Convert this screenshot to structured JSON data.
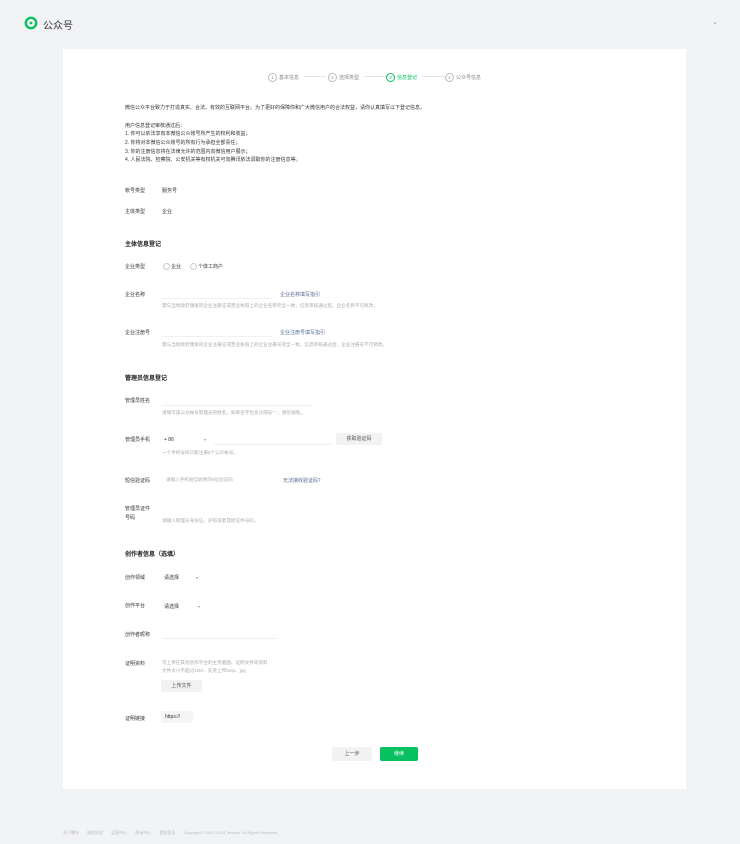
{
  "header": {
    "brand": "公众号"
  },
  "steps": [
    {
      "num": "1",
      "label": "基本信息"
    },
    {
      "num": "2",
      "label": "选择类型"
    },
    {
      "num": "3",
      "label": "信息登记"
    },
    {
      "num": "4",
      "label": "公众号信息"
    }
  ],
  "intro": {
    "line1": "微信公众平台致力于打造真实、合法、有效的互联网平台。为了更好的保障你和广大微信用户的合法权益，请你认真填写以下登记信息。",
    "review_title": "用户信息登记审核通过后：",
    "items": [
      "1. 你可以依法享有本微信公众账号所产生的权利和收益；",
      "2. 你将对本微信公众账号的所有行为承担全部责任；",
      "3. 你的注册信息将在法律允许的范围内向微信用户展示；",
      "4. 人民法院、检察院、公安机关等有权机关可向腾讯依法调取你的注册信息等。"
    ]
  },
  "account": {
    "type_label": "帐号类型",
    "type_value": "服务号",
    "subject_label": "主体类型",
    "subject_value": "企业"
  },
  "subject_section": {
    "title": "主体信息登记",
    "org_type_label": "企业类型",
    "org_type_options": [
      "企业",
      "个体工商户"
    ],
    "name_label": "企业名称",
    "name_link": "企业名称填写指引",
    "name_hint": "需与当地政府颁发的企业注册证或营业执照上的企业名称完全一致，信息审核通过后，企业名称不可修改。",
    "reg_label": "企业注册号",
    "reg_link": "企业注册号填写指引",
    "reg_hint": "需与当地政府颁发的企业注册证或营业执照上的企业注册号完全一致，信息审核通过后，企业注册号不可修改。"
  },
  "admin_section": {
    "title": "管理员信息登记",
    "name_label": "管理员姓名",
    "name_hint": "请填写该公众帐号管理员的姓名，如果名字包含分隔号\"·\"，请勿省略。",
    "phone_label": "管理员手机",
    "phone_prefix": "+ 86",
    "sms_button": "获取验证码",
    "phone_hint": "一个手机号码只能注册5个公众帐号。",
    "code_label": "短信验证码",
    "code_placeholder": "请输入手机短信收到的6位验证码",
    "code_link": "无法接收验证码？",
    "id_label_1": "管理员证件",
    "id_label_2": "号码",
    "id_placeholder": "请输入管理员身份证，护照或者其他证件号码。"
  },
  "creator_section": {
    "title": "创作者信息（选填）",
    "field_label": "创作领域",
    "field_select": "请选择",
    "platform_label": "创作平台",
    "platform_select": "请选择",
    "nickname_label": "创作者昵称",
    "proof_label": "证明资料",
    "proof_hint_1": "可上传在其他创作平台的主页截图、证明文件等资料",
    "proof_hint_2": "文件大小不超过10M，支持上传bmp、jpg",
    "upload_button": "上传文件",
    "link_label": "证明链接",
    "link_value": "https://"
  },
  "actions": {
    "prev": "上一步",
    "next": "继续"
  },
  "footer": [
    "关于腾讯",
    "服务协议",
    "运营中心",
    "辟谣中心",
    "侵权投诉",
    "Copyright © 2012-2024 Tencent. All Rights Reserved."
  ],
  "colors": {
    "accent": "#07c160",
    "link": "#576b95",
    "background": "#f2f3f5"
  }
}
